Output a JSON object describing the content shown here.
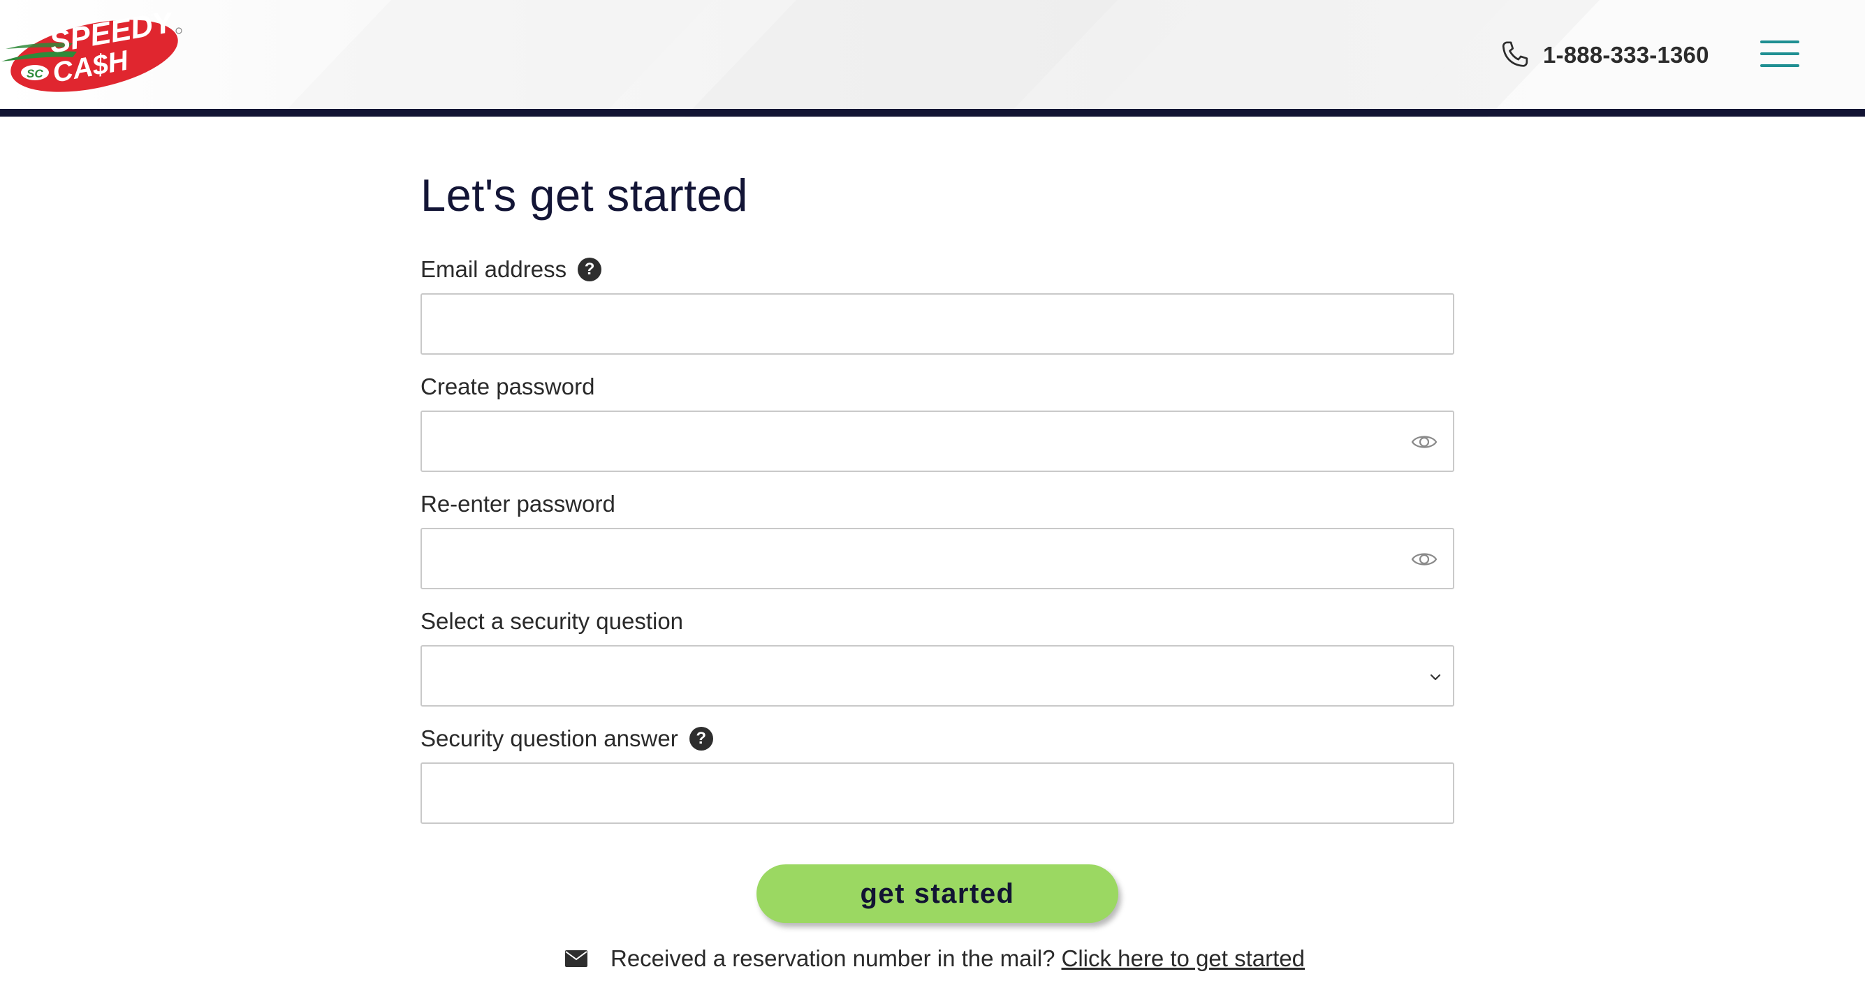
{
  "header": {
    "logo_text_top": "SPEEDY",
    "logo_text_bottom": "CA$H",
    "logo_badge": "SC",
    "phone_number": "1-888-333-1360",
    "icons": {
      "phone": "phone-icon",
      "menu": "hamburger-menu-icon",
      "logo": "speedy-cash-logo"
    },
    "colors": {
      "header_bar": "#121433",
      "menu_icon": "#1f8f92",
      "logo_red": "#e0262f",
      "logo_green": "#2f8a3a"
    }
  },
  "form": {
    "title": "Let's get started",
    "fields": {
      "email": {
        "label": "Email address",
        "value": "",
        "help": "?"
      },
      "password": {
        "label": "Create password",
        "value": ""
      },
      "reenter_password": {
        "label": "Re-enter password",
        "value": ""
      },
      "security_question": {
        "label": "Select a security question",
        "selected": ""
      },
      "security_answer": {
        "label": "Security question answer",
        "value": "",
        "help": "?"
      }
    },
    "submit_label": "get started",
    "colors": {
      "submit_bg": "#9bd862",
      "title": "#131536"
    }
  },
  "reservation": {
    "text": "Received a reservation number in the mail?",
    "link_label": "Click here to get started",
    "icon": "envelope-icon"
  }
}
